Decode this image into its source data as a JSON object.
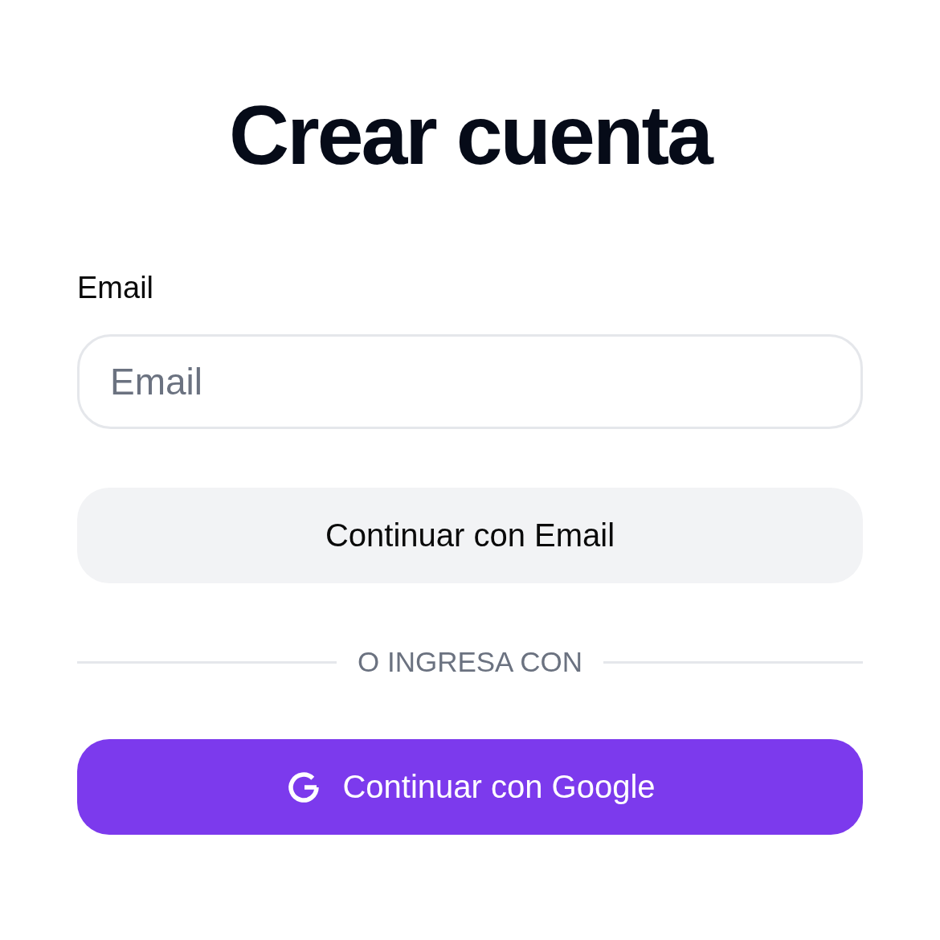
{
  "title": "Crear cuenta",
  "email_field": {
    "label": "Email",
    "placeholder": "Email"
  },
  "email_button": "Continuar con Email",
  "divider": "O INGRESA CON",
  "google_button": "Continuar con Google"
}
